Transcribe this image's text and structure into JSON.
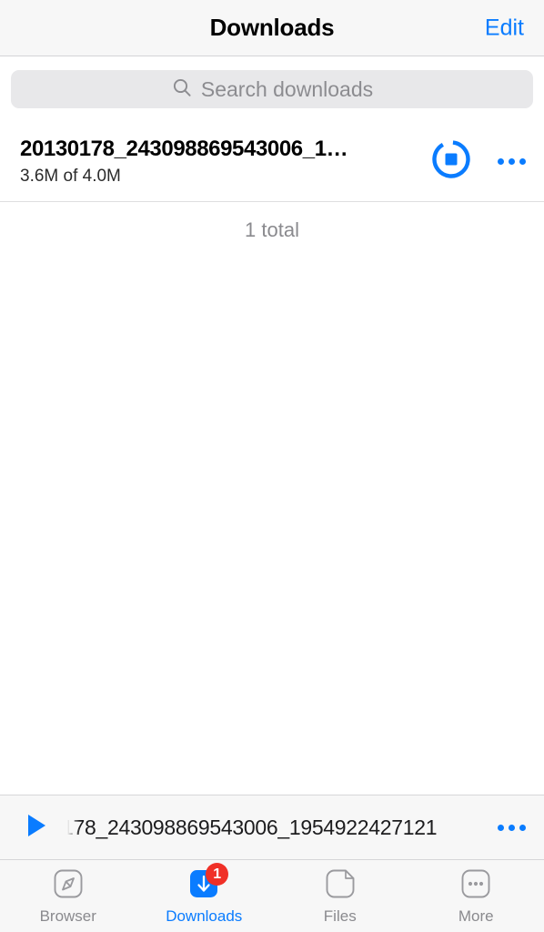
{
  "header": {
    "title": "Downloads",
    "edit_label": "Edit"
  },
  "search": {
    "placeholder": "Search downloads",
    "value": "",
    "icon": "search-icon"
  },
  "downloads": {
    "items": [
      {
        "name": "20130178_243098869543006_1…",
        "progress_text": "3.6M of 4.0M",
        "downloaded": "3.6M",
        "total_size": "4.0M",
        "progress_percent": 90,
        "action_icon": "stop-icon",
        "more_icon": "ellipsis-icon"
      }
    ],
    "total_label": "1 total"
  },
  "mini_player": {
    "play_icon": "play-icon",
    "track_title": "178_243098869543006_1954922427121",
    "more_icon": "ellipsis-icon"
  },
  "tab_bar": {
    "tabs": [
      {
        "label": "Browser",
        "icon": "compass-icon",
        "active": false,
        "badge": ""
      },
      {
        "label": "Downloads",
        "icon": "download-icon",
        "active": true,
        "badge": "1"
      },
      {
        "label": "Files",
        "icon": "file-icon",
        "active": false,
        "badge": ""
      },
      {
        "label": "More",
        "icon": "ellipsis-icon",
        "active": false,
        "badge": ""
      }
    ]
  },
  "colors": {
    "accent_blue": "#0a7cff",
    "badge_red": "#f03027",
    "chrome_gray": "#f7f7f7",
    "search_fill": "#e8e8ea",
    "muted_text": "#8a8a8e"
  }
}
